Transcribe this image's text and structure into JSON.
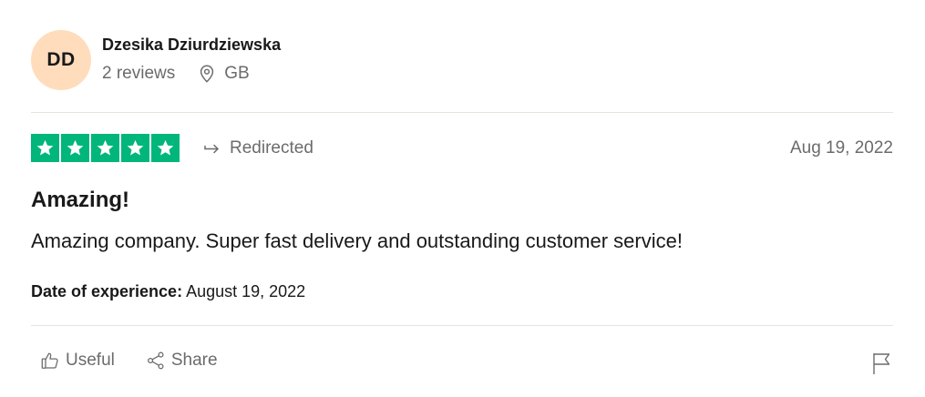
{
  "consumer": {
    "initials": "DD",
    "name": "Dzesika Dziurdziewska",
    "reviews": "2 reviews",
    "country": "GB",
    "avatar_color": "#ffdcbc"
  },
  "review": {
    "rating": 5,
    "rating_max": 5,
    "star_color": "#00b67a",
    "source": "Redirected",
    "date": "Aug 19, 2022",
    "title": "Amazing!",
    "body": "Amazing company. Super fast delivery and outstanding customer service!",
    "experience_label": "Date of experience:",
    "experience_date": "August 19, 2022"
  },
  "actions": {
    "useful_label": "Useful",
    "share_label": "Share"
  },
  "icons": {
    "location": "location-pin-icon",
    "redirect": "redirect-arrow-icon",
    "star": "star-icon",
    "useful": "thumbs-up-icon",
    "share": "share-icon",
    "report": "flag-icon"
  }
}
